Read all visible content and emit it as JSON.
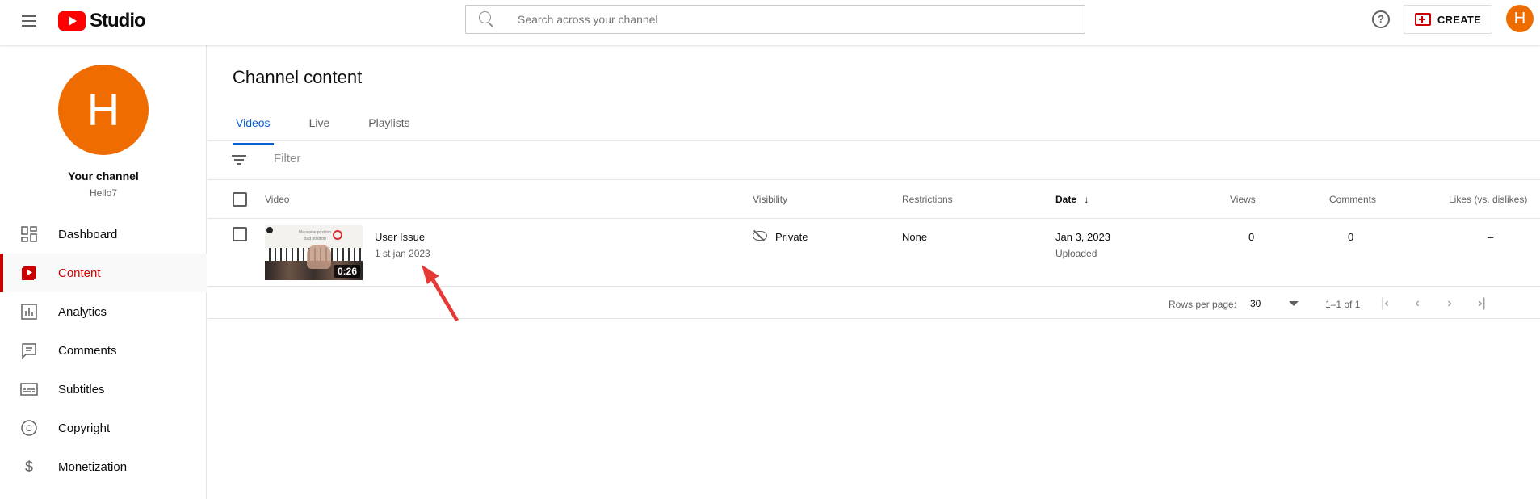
{
  "header": {
    "logo_text": "Studio",
    "search_placeholder": "Search across your channel",
    "help_label": "?",
    "create_label": "CREATE",
    "avatar_letter": "H"
  },
  "sidebar": {
    "avatar_letter": "H",
    "channel_title": "Your channel",
    "channel_handle": "Hello7",
    "items": [
      {
        "label": "Dashboard",
        "icon": "dashboard-icon",
        "active": false
      },
      {
        "label": "Content",
        "icon": "content-icon",
        "active": true
      },
      {
        "label": "Analytics",
        "icon": "analytics-icon",
        "active": false
      },
      {
        "label": "Comments",
        "icon": "comments-icon",
        "active": false
      },
      {
        "label": "Subtitles",
        "icon": "subtitles-icon",
        "active": false
      },
      {
        "label": "Copyright",
        "icon": "copyright-icon",
        "active": false
      },
      {
        "label": "Monetization",
        "icon": "monetization-icon",
        "active": false
      }
    ]
  },
  "main": {
    "page_title": "Channel content",
    "tabs": [
      {
        "label": "Videos",
        "active": true
      },
      {
        "label": "Live",
        "active": false
      },
      {
        "label": "Playlists",
        "active": false
      }
    ],
    "filter_placeholder": "Filter",
    "columns": {
      "video": "Video",
      "visibility": "Visibility",
      "restrictions": "Restrictions",
      "date": "Date",
      "views": "Views",
      "comments": "Comments",
      "likes": "Likes (vs. dislikes)"
    },
    "rows": [
      {
        "title": "User Issue",
        "description": "1 st jan 2023",
        "duration": "0:26",
        "thumbnail_caption": "Mauvaise position\nBad position",
        "visibility": "Private",
        "restrictions": "None",
        "date": "Jan 3, 2023",
        "date_status": "Uploaded",
        "views": "0",
        "comments": "0",
        "likes": "–"
      }
    ],
    "pagination": {
      "rows_per_page_label": "Rows per page:",
      "rows_per_page": "30",
      "range": "1–1 of 1"
    }
  },
  "colors": {
    "accent_red": "#cc0000",
    "tab_blue": "#065fd4",
    "avatar_orange": "#ef6c00",
    "annotation_arrow": "#e53935"
  }
}
